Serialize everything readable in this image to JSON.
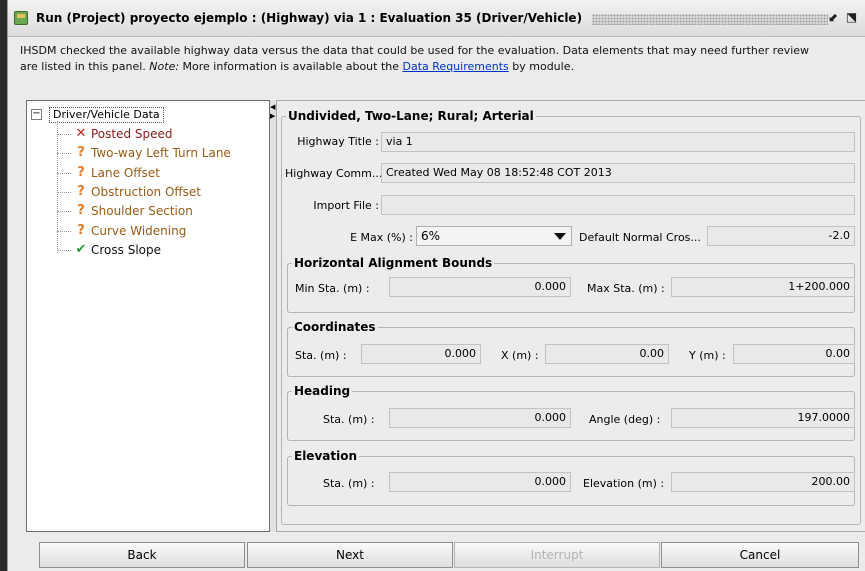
{
  "window": {
    "title": "Run (Project) proyecto ejemplo : (Highway) via 1 : Evaluation 35 (Driver/Vehicle)",
    "title_icon": "project-run-icon",
    "restore_glyph": "⬋",
    "maximize_glyph": "⬔"
  },
  "intro": {
    "line1": "IHSDM checked the available highway data versus the data that could be used for the evaluation. Data elements that may need further review",
    "line2_a": "are listed in this panel. ",
    "line2_note": "Note:",
    "line2_b": " More information is available about the ",
    "link": "Data Requirements",
    "line2_c": " by module."
  },
  "tree": {
    "expander": "−",
    "root": "Driver/Vehicle Data",
    "items": [
      {
        "label": "Posted Speed",
        "status": "error",
        "icon": "x-icon",
        "glyph": "✕",
        "color": "#8b1a1a",
        "icon_color": "#c0281e"
      },
      {
        "label": "Two-way Left Turn Lane",
        "status": "warning",
        "icon": "question-icon",
        "glyph": "?",
        "color": "#9a5b14",
        "icon_color": "#e07a28"
      },
      {
        "label": "Lane Offset",
        "status": "warning",
        "icon": "question-icon",
        "glyph": "?",
        "color": "#9a5b14",
        "icon_color": "#e07a28"
      },
      {
        "label": "Obstruction Offset",
        "status": "warning",
        "icon": "question-icon",
        "glyph": "?",
        "color": "#9a5b14",
        "icon_color": "#e07a28"
      },
      {
        "label": "Shoulder Section",
        "status": "warning",
        "icon": "question-icon",
        "glyph": "?",
        "color": "#9a5b14",
        "icon_color": "#e07a28"
      },
      {
        "label": "Curve Widening",
        "status": "warning",
        "icon": "question-icon",
        "glyph": "?",
        "color": "#9a5b14",
        "icon_color": "#e07a28"
      },
      {
        "label": "Cross Slope",
        "status": "ok",
        "icon": "checkmark-icon",
        "glyph": "✔",
        "color": "#111111",
        "icon_color": "#2e9a3a"
      }
    ]
  },
  "splitter": {
    "arrow_left": "◀",
    "arrow_right": "▶"
  },
  "main": {
    "section_title": "Undivided, Two-Lane; Rural; Arterial",
    "highway_title_label": "Highway Title :",
    "highway_title": "via 1",
    "highway_comment_label": "Highway Comm...",
    "highway_comment": "Created Wed May 08 18:52:48 COT 2013",
    "import_file_label": "Import File :",
    "import_file": "",
    "emax_label": "E Max (%) :",
    "emax": "6%",
    "default_cross_label": "Default Normal Cros...",
    "default_cross": "-2.0",
    "horizontal": {
      "title": "Horizontal Alignment Bounds",
      "min_label": "Min Sta. (m) :",
      "min": "0.000",
      "max_label": "Max Sta. (m) :",
      "max": "1+200.000"
    },
    "coordinates": {
      "title": "Coordinates",
      "sta_label": "Sta. (m) :",
      "sta": "0.000",
      "x_label": "X (m) :",
      "x": "0.00",
      "y_label": "Y (m) :",
      "y": "0.00"
    },
    "heading": {
      "title": "Heading",
      "sta_label": "Sta. (m) :",
      "sta": "0.000",
      "angle_label": "Angle (deg) :",
      "angle": "197.0000"
    },
    "elevation": {
      "title": "Elevation",
      "sta_label": "Sta. (m) :",
      "sta": "0.000",
      "elev_label": "Elevation (m) :",
      "elev": "200.00"
    }
  },
  "buttons": {
    "back": "Back",
    "next": "Next",
    "interrupt": "Interrupt",
    "cancel": "Cancel"
  }
}
